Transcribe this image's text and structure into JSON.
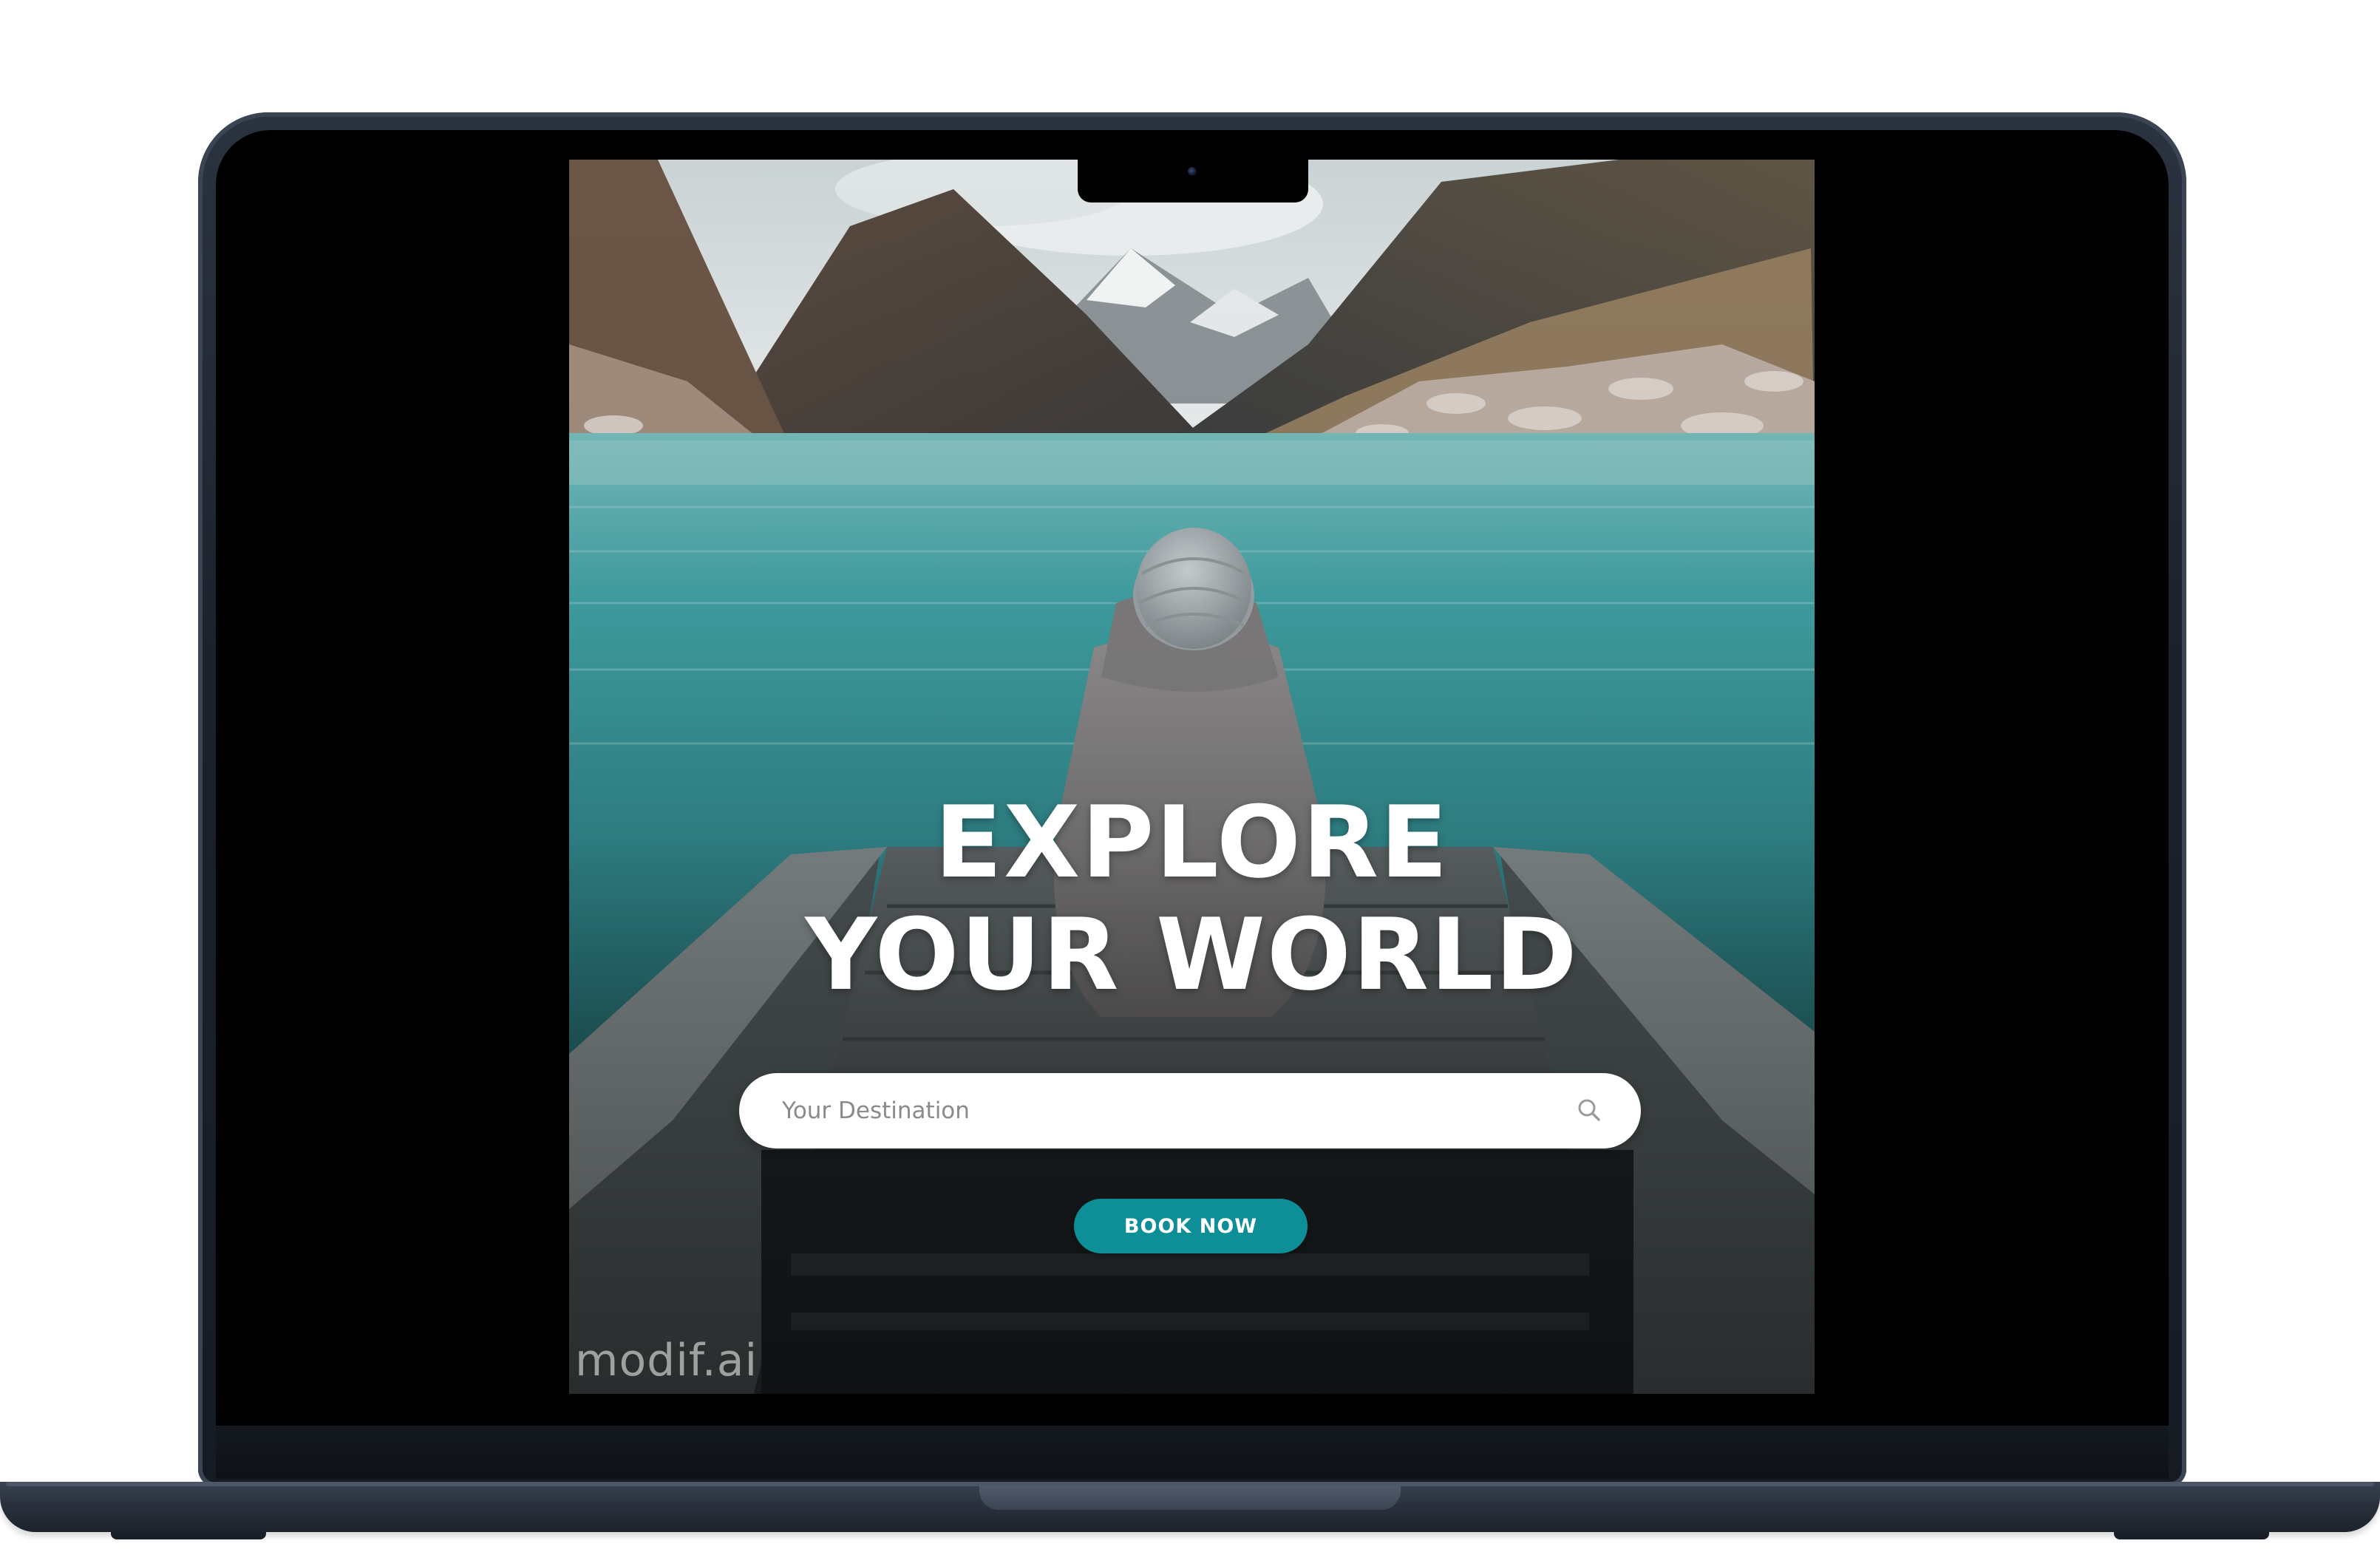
{
  "hero": {
    "headline_line1": "EXPLORE",
    "headline_line2": "YOUR WORLD"
  },
  "search": {
    "placeholder": "Your Destination",
    "value": "",
    "icon": "search-icon"
  },
  "cta": {
    "label": "BOOK NOW"
  },
  "watermark": {
    "text": "modif.ai"
  },
  "colors": {
    "accent": "#0e8f98",
    "laptop_body": "#1c222c"
  }
}
